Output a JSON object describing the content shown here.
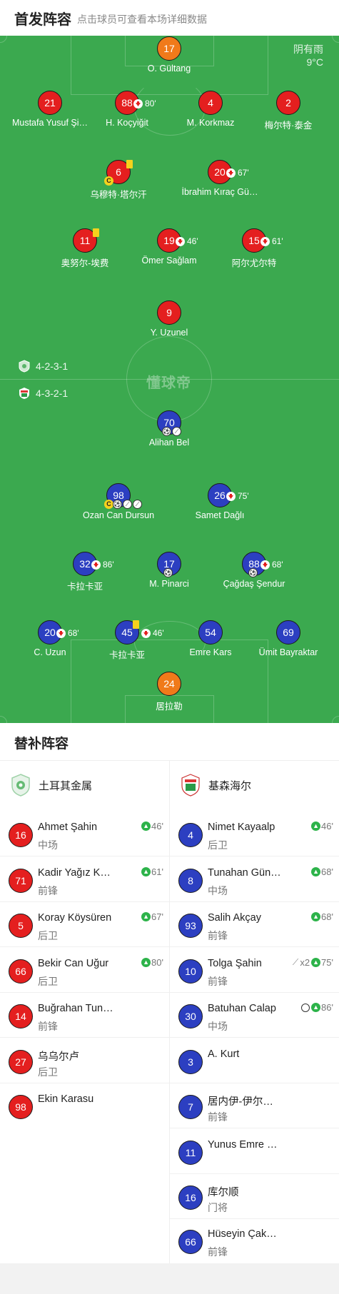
{
  "header": {
    "title": "首发阵容",
    "hint": "点击球员可查看本场详细数据"
  },
  "weather": {
    "condition": "阴有雨",
    "temperature": "9°C"
  },
  "watermark": "懂球帝",
  "formations": {
    "home": "4-2-3-1",
    "away": "4-3-2-1"
  },
  "home_lineup": [
    {
      "number": "17",
      "name": "O. Gültang",
      "color": "orange"
    },
    {
      "number": "21",
      "name": "Mustafa Yusuf Şi…",
      "color": "red"
    },
    {
      "number": "88",
      "name": "H. Koçyiğit",
      "color": "red",
      "sub_minute": "80'"
    },
    {
      "number": "4",
      "name": "M. Korkmaz",
      "color": "red"
    },
    {
      "number": "2",
      "name": "梅尔特·泰金",
      "color": "red"
    },
    {
      "number": "6",
      "name": "乌穆特·塔尔汗",
      "color": "red",
      "yellow_card": true,
      "captain": "C"
    },
    {
      "number": "20",
      "name": "İbrahim Kıraç Gü…",
      "color": "red",
      "sub_minute": "67'"
    },
    {
      "number": "11",
      "name": "奥努尔-埃费",
      "color": "red",
      "yellow_card": true
    },
    {
      "number": "19",
      "name": "Ömer Sağlam",
      "color": "red",
      "sub_minute": "46'"
    },
    {
      "number": "15",
      "name": "阿尔尤尔特",
      "color": "red",
      "sub_minute": "61'"
    },
    {
      "number": "9",
      "name": "Y. Uzunel",
      "color": "red"
    }
  ],
  "away_lineup": [
    {
      "number": "70",
      "name": "Alihan Bel",
      "color": "blue",
      "balls": 2
    },
    {
      "number": "98",
      "name": "Ozan Can Dursun",
      "color": "blue",
      "balls": 3,
      "captain": "C"
    },
    {
      "number": "26",
      "name": "Samet Dağlı",
      "color": "blue",
      "sub_minute": "75'"
    },
    {
      "number": "32",
      "name": "卡拉卡亚",
      "color": "blue",
      "sub_minute": "86'"
    },
    {
      "number": "17",
      "name": "M. Pinarci",
      "color": "blue",
      "balls": 1
    },
    {
      "number": "88",
      "name": "Çağdaş Şendur",
      "color": "blue",
      "sub_minute": "68'",
      "balls": 1
    },
    {
      "number": "20",
      "name": "C. Uzun",
      "color": "blue",
      "sub_minute": "68'"
    },
    {
      "number": "45",
      "name": "卡拉卡亚",
      "color": "blue",
      "sub_minute": "46'",
      "yellow_card": true
    },
    {
      "number": "54",
      "name": "Emre Kars",
      "color": "blue"
    },
    {
      "number": "69",
      "name": "Ümit Bayraktar",
      "color": "blue"
    },
    {
      "number": "24",
      "name": "居拉勒",
      "color": "orange"
    }
  ],
  "subs": {
    "title": "替补阵容",
    "home_team": "土耳其金属",
    "away_team": "基森海尔",
    "home": [
      {
        "number": "16",
        "name": "Ahmet Şahin",
        "position": "中场",
        "minute": "46'"
      },
      {
        "number": "71",
        "name": "Kadir Yağız K…",
        "position": "前锋",
        "minute": "61'"
      },
      {
        "number": "5",
        "name": "Koray Köysüren",
        "position": "后卫",
        "minute": "67'"
      },
      {
        "number": "66",
        "name": "Bekir Can Uğur",
        "position": "后卫",
        "minute": "80'"
      },
      {
        "number": "14",
        "name": "Buğrahan Tun…",
        "position": "前锋",
        "minute": ""
      },
      {
        "number": "27",
        "name": "乌乌尔卢",
        "position": "后卫",
        "minute": ""
      },
      {
        "number": "98",
        "name": "Ekin Karasu",
        "position": "",
        "minute": ""
      }
    ],
    "away": [
      {
        "number": "4",
        "name": "Nimet Kayaalp",
        "position": "后卫",
        "minute": "46'"
      },
      {
        "number": "8",
        "name": "Tunahan Gün…",
        "position": "中场",
        "minute": "68'"
      },
      {
        "number": "93",
        "name": "Salih Akçay",
        "position": "前锋",
        "minute": "68'"
      },
      {
        "number": "10",
        "name": "Tolga Şahin",
        "position": "前锋",
        "minute": "75'",
        "extra": "x2"
      },
      {
        "number": "30",
        "name": "Batuhan Calap",
        "position": "中场",
        "minute": "86'",
        "ball": true
      },
      {
        "number": "3",
        "name": "A. Kurt",
        "position": "",
        "minute": ""
      },
      {
        "number": "7",
        "name": "居内伊-伊尔…",
        "position": "前锋",
        "minute": ""
      },
      {
        "number": "11",
        "name": "Yunus Emre …",
        "position": "",
        "minute": ""
      },
      {
        "number": "16",
        "name": "库尔顺",
        "position": "门将",
        "minute": ""
      },
      {
        "number": "66",
        "name": "Hüseyin Çak…",
        "position": "前锋",
        "minute": ""
      }
    ]
  }
}
